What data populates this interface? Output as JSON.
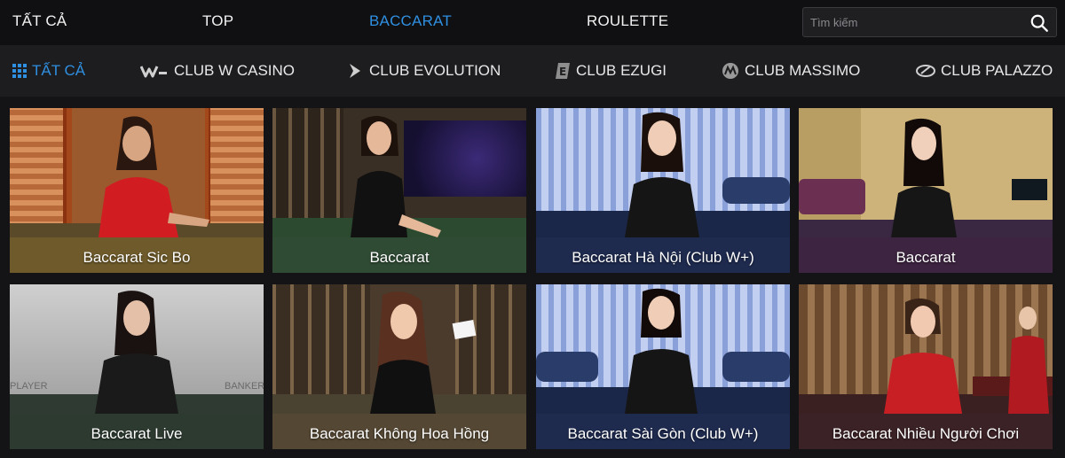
{
  "top_tabs": [
    {
      "label": "TẤT CẢ",
      "active": false
    },
    {
      "label": "TOP",
      "active": false
    },
    {
      "label": "BACCARAT",
      "active": true
    },
    {
      "label": "ROULETTE",
      "active": false
    }
  ],
  "search": {
    "placeholder": "Tìm kiếm",
    "icon": "search-icon"
  },
  "clubs": [
    {
      "label": "TẤT CẢ",
      "icon": "grid-icon",
      "active": true
    },
    {
      "label": "CLUB W CASINO",
      "icon": "w-casino-logo-icon",
      "active": false
    },
    {
      "label": "CLUB EVOLUTION",
      "icon": "evolution-logo-icon",
      "active": false
    },
    {
      "label": "CLUB EZUGI",
      "icon": "ezugi-logo-icon",
      "active": false
    },
    {
      "label": "CLUB MASSIMO",
      "icon": "massimo-logo-icon",
      "active": false
    },
    {
      "label": "CLUB PALAZZO",
      "icon": "palazzo-logo-icon",
      "active": false
    }
  ],
  "games": [
    {
      "name": "Baccarat Sic Bo"
    },
    {
      "name": "Baccarat"
    },
    {
      "name": "Baccarat Hà Nội (Club W+)"
    },
    {
      "name": "Baccarat"
    },
    {
      "name": "Baccarat Live"
    },
    {
      "name": "Baccarat Không Hoa Hồng"
    },
    {
      "name": "Baccarat Sài Gòn (Club W+)"
    },
    {
      "name": "Baccarat Nhiều Người Chơi"
    }
  ],
  "colors": {
    "accent": "#2f8fe0",
    "nav_bg": "#101012",
    "subnav_bg": "#1d1d20"
  }
}
